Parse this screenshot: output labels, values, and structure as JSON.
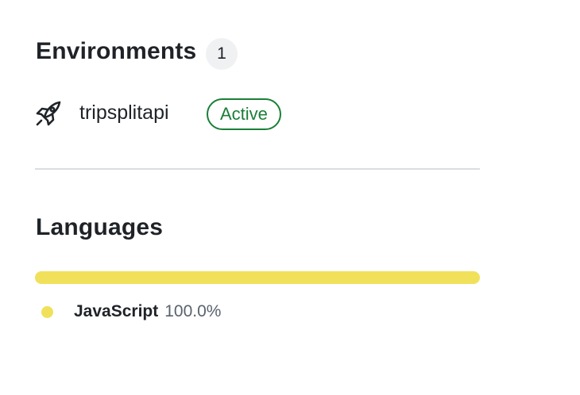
{
  "environments": {
    "title": "Environments",
    "count": "1",
    "items": [
      {
        "icon": "rocket-icon",
        "name": "tripsplitapi",
        "status": "Active",
        "status_color": "#1a7f37"
      }
    ]
  },
  "languages": {
    "title": "Languages",
    "items": [
      {
        "name": "JavaScript",
        "percent_label": "100.0%",
        "percent": 100.0,
        "color": "#f1e05a"
      }
    ]
  }
}
